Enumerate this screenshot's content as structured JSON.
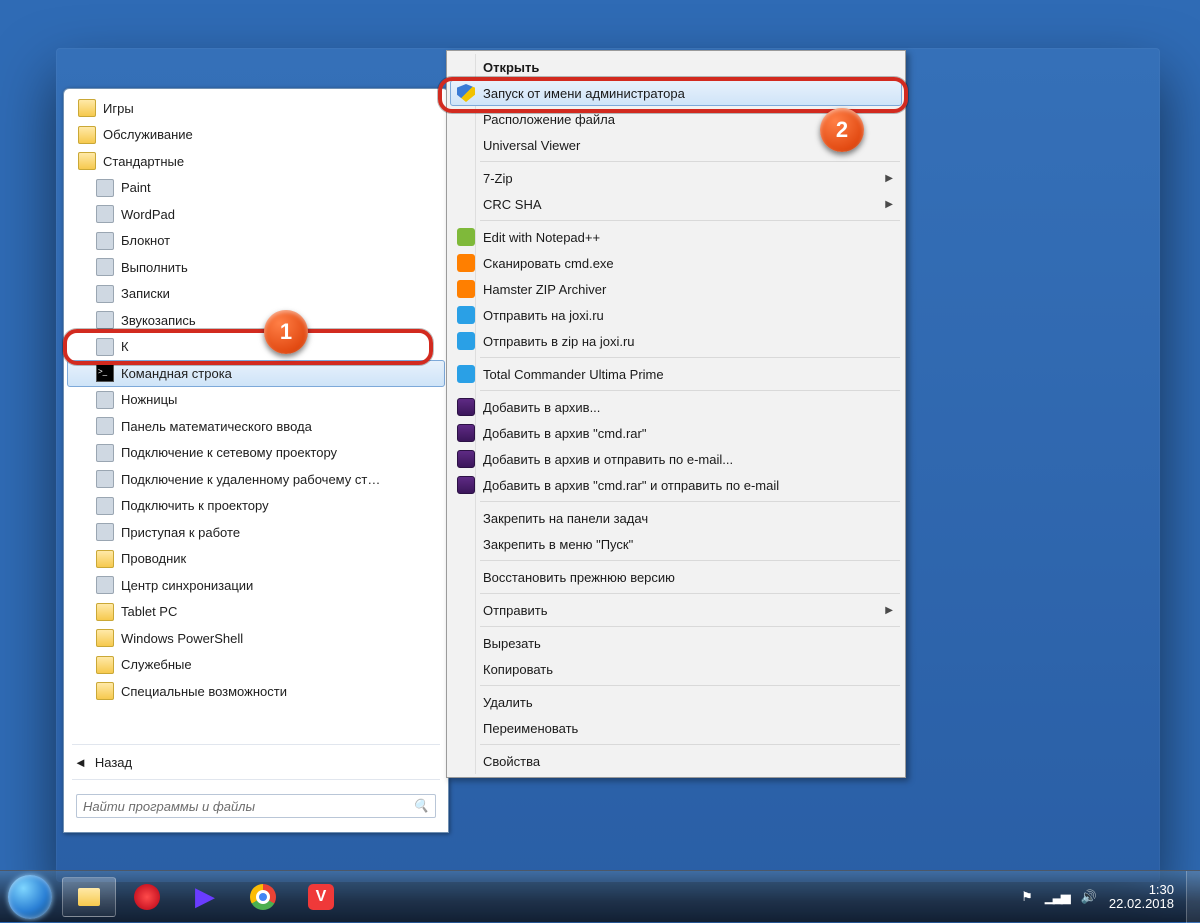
{
  "start_menu": {
    "items": [
      {
        "label": "Игры",
        "iconClass": "ic-folder",
        "indent": 0
      },
      {
        "label": "Обслуживание",
        "iconClass": "ic-folder",
        "indent": 0
      },
      {
        "label": "Стандартные",
        "iconClass": "ic-folder",
        "indent": 0
      },
      {
        "label": "Paint",
        "iconClass": "ic-generic",
        "indent": 1
      },
      {
        "label": "WordPad",
        "iconClass": "ic-generic",
        "indent": 1
      },
      {
        "label": "Блокнот",
        "iconClass": "ic-generic",
        "indent": 1
      },
      {
        "label": "Выполнить",
        "iconClass": "ic-generic",
        "indent": 1
      },
      {
        "label": "Записки",
        "iconClass": "ic-generic",
        "indent": 1
      },
      {
        "label": "Звукозапись",
        "iconClass": "ic-generic",
        "indent": 1
      },
      {
        "label": "К",
        "iconClass": "ic-generic",
        "indent": 1
      },
      {
        "label": "Командная строка",
        "iconClass": "ic-cmd",
        "indent": 1,
        "selected": true
      },
      {
        "label": "Ножницы",
        "iconClass": "ic-generic",
        "indent": 1
      },
      {
        "label": "Панель математического ввода",
        "iconClass": "ic-generic",
        "indent": 1
      },
      {
        "label": "Подключение к сетевому проектору",
        "iconClass": "ic-generic",
        "indent": 1
      },
      {
        "label": "Подключение к удаленному рабочему ст…",
        "iconClass": "ic-generic",
        "indent": 1
      },
      {
        "label": "Подключить к проектору",
        "iconClass": "ic-generic",
        "indent": 1
      },
      {
        "label": "Приступая к работе",
        "iconClass": "ic-generic",
        "indent": 1
      },
      {
        "label": "Проводник",
        "iconClass": "ic-folder",
        "indent": 1
      },
      {
        "label": "Центр синхронизации",
        "iconClass": "ic-generic",
        "indent": 1
      },
      {
        "label": "Tablet PC",
        "iconClass": "ic-folder",
        "indent": 1
      },
      {
        "label": "Windows PowerShell",
        "iconClass": "ic-folder",
        "indent": 1
      },
      {
        "label": "Служебные",
        "iconClass": "ic-folder",
        "indent": 1
      },
      {
        "label": "Специальные возможности",
        "iconClass": "ic-folder",
        "indent": 1
      }
    ],
    "back_label": "Назад",
    "search_placeholder": "Найти программы и файлы"
  },
  "context_menu": {
    "groups": [
      [
        {
          "label": "Открыть",
          "bold": true
        },
        {
          "label": "Запуск от имени администратора",
          "icon": "shield",
          "hover": true
        },
        {
          "label": "Расположение файла"
        },
        {
          "label": "Universal Viewer"
        }
      ],
      [
        {
          "label": "7-Zip",
          "submenu": true
        },
        {
          "label": "CRC SHA",
          "submenu": true
        }
      ],
      [
        {
          "label": "Edit with Notepad++",
          "icon": "npp"
        },
        {
          "label": "Сканировать cmd.exe",
          "icon": "avast"
        },
        {
          "label": "Hamster ZIP Archiver",
          "icon": "hamster"
        },
        {
          "label": "Отправить на joxi.ru",
          "icon": "joxi"
        },
        {
          "label": "Отправить в zip на joxi.ru",
          "icon": "joxi"
        }
      ],
      [
        {
          "label": "Total Commander Ultima Prime",
          "icon": "tc"
        }
      ],
      [
        {
          "label": "Добавить в архив...",
          "icon": "rar"
        },
        {
          "label": "Добавить в архив \"cmd.rar\"",
          "icon": "rar"
        },
        {
          "label": "Добавить в архив и отправить по e-mail...",
          "icon": "rar"
        },
        {
          "label": "Добавить в архив \"cmd.rar\" и отправить по e-mail",
          "icon": "rar"
        }
      ],
      [
        {
          "label": "Закрепить на панели задач"
        },
        {
          "label": "Закрепить в меню \"Пуск\""
        }
      ],
      [
        {
          "label": "Восстановить прежнюю версию"
        }
      ],
      [
        {
          "label": "Отправить",
          "submenu": true
        }
      ],
      [
        {
          "label": "Вырезать"
        },
        {
          "label": "Копировать"
        }
      ],
      [
        {
          "label": "Удалить"
        },
        {
          "label": "Переименовать"
        }
      ],
      [
        {
          "label": "Свойства"
        }
      ]
    ]
  },
  "taskbar": {
    "time": "1:30",
    "date": "22.02.2018"
  },
  "callouts": {
    "badge1": "1",
    "badge2": "2"
  }
}
